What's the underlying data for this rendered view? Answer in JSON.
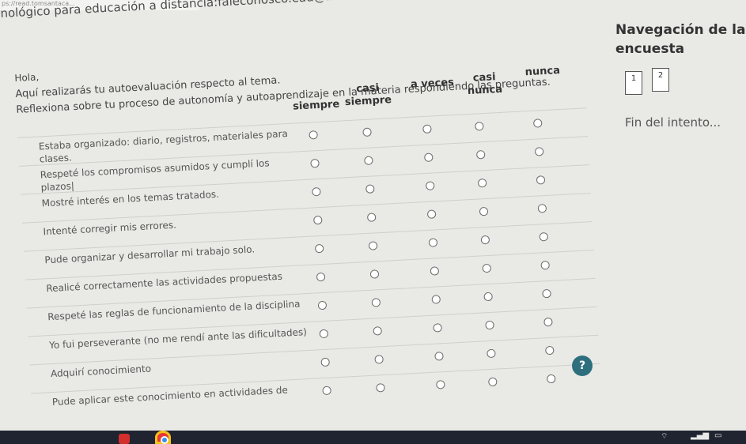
{
  "browser": {
    "url": "ps://read.tomsantaca..."
  },
  "header": {
    "text": "nológico para educación a distancia:faleconosco.ead@ifcm..."
  },
  "quiz": {
    "greeting": "Hola,",
    "intro": "Aquí realizarás tu autoevaluación respecto al tema.",
    "instruction": "Reflexiona sobre tu proceso de autonomía y autoaprendizaje en la materia respondiendo las preguntas.",
    "columns": [
      "siempre",
      "casi siempre",
      "a veces",
      "casi nunca",
      "nunca"
    ],
    "rows": [
      "Estaba organizado: diario, registros, materiales para clases.",
      "Respeté los compromisos asumidos y cumplí los plazos|",
      "Mostré interés en los temas tratados.",
      "Intenté corregir mis errores.",
      "Pude organizar y desarrollar mi trabajo solo.",
      "Realicé correctamente las actividades propuestas",
      "Respeté las reglas de funcionamiento de la disciplina",
      "Yo fui perseverante (no me rendí ante las dificultades)",
      "Adquirí conocimiento",
      "Pude aplicar este conocimiento en actividades de"
    ]
  },
  "navigation": {
    "title": "Navegación de la encuesta",
    "pages": [
      "1",
      "2"
    ],
    "finish": "Fin del intento..."
  },
  "help": {
    "label": "?"
  },
  "colors": {
    "help_button": "#2e6f7e",
    "taskbar": "#1f2430"
  },
  "icons": [
    "chrome-icon",
    "wifi-icon",
    "signal-icon",
    "battery-icon",
    "help-icon"
  ]
}
